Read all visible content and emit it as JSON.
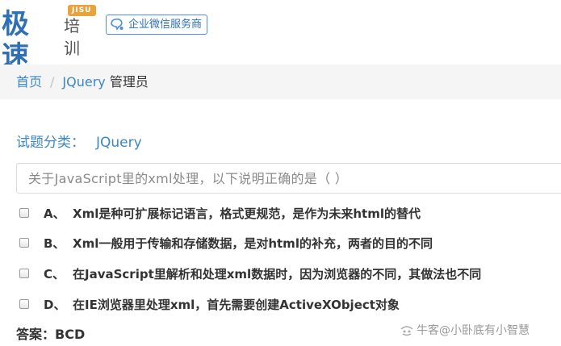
{
  "header": {
    "logo_text": "极速",
    "logo_sub": "培训",
    "logo_badge": "JISU",
    "partner_label": "企业微信服务商"
  },
  "breadcrumb": {
    "home": "首页",
    "separator": "/",
    "category": "JQuery",
    "current": "管理员"
  },
  "category": {
    "label": "试题分类：",
    "value": "JQuery"
  },
  "question": {
    "text": "关于JavaScript里的xml处理，以下说明正确的是（  ）"
  },
  "options": [
    {
      "letter": "A、",
      "text": "Xml是种可扩展标记语言，格式更规范，是作为未来html的替代",
      "checked": false
    },
    {
      "letter": "B、",
      "text": "Xml一般用于传输和存储数据，是对html的补充，两者的目的不同",
      "checked": false
    },
    {
      "letter": "C、",
      "text": "在JavaScript里解析和处理xml数据时，因为浏览器的不同，其做法也不同",
      "checked": false
    },
    {
      "letter": "D、",
      "text": "在IE浏览器里处理xml，首先需要创建ActiveXObject对象",
      "checked": false
    }
  ],
  "answer": {
    "text": "答案：BCD"
  },
  "watermark": {
    "text": "牛客@小卧底有小智慧",
    "icon": "niuke-logo-icon"
  },
  "colors": {
    "brand_blue": "#2e6fb7",
    "link_blue": "#3a87c9",
    "badge_orange": "#e8a33c",
    "breadcrumb_bg": "#f5f5f5"
  }
}
